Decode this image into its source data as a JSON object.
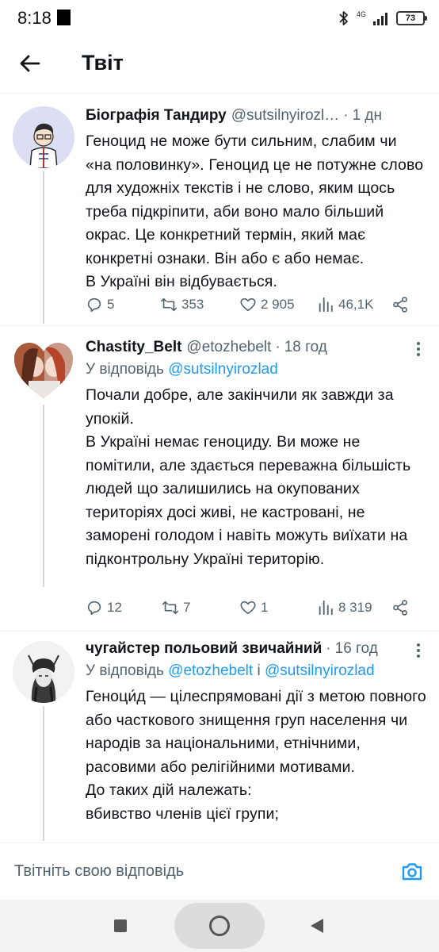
{
  "status_bar": {
    "time": "8:18",
    "network": "4G",
    "battery": "73"
  },
  "header": {
    "title": "Твіт"
  },
  "tweets": [
    {
      "author": "Біографія Тандиру",
      "handle": "@sutsilnyirozl…",
      "time": "1 дн",
      "text": "Геноцид не може бути сильним, слабим чи «на половинку». Геноцид це не потужне слово для художніх текстів і не слово, яким щось треба підкріпити, аби воно мало більший окрас. Це конкретний термін, який має конкретні ознаки. Він або є або немає.\nВ Україні він відбувається.",
      "replies": "5",
      "retweets": "353",
      "likes": "2 905",
      "views": "46,1K"
    },
    {
      "author": "Chastity_Belt",
      "handle": "@etozhebelt",
      "time": "18 год",
      "reply_prefix": "У відповідь",
      "reply_mention": "@sutsilnyirozlad",
      "text": "Почали добре, але закінчили як завжди за упокій.\nВ Україні немає геноциду. Ви може не помітили, але здається переважна більшість людей що залишились на окупованих територіях досі живі, не кастровані, не заморені голодом і навіть можуть виїхати на підконтрольну Україні територію.",
      "replies": "12",
      "retweets": "7",
      "likes": "1",
      "views": "8 319"
    },
    {
      "author": "чугайстер польовий звичайний",
      "time": "16 год",
      "reply_prefix": "У відповідь",
      "reply_mention": "@etozhebelt",
      "reply_join": "і",
      "reply_mention2": "@sutsilnyirozlad",
      "text": "Геноци́д — цілеспрямовані дії з метою повного або часткового знищення груп населення чи народів за національними, етнічними, расовими або релігійними мотивами.\nДо таких дій належать:\nвбивство членів цієї групи;"
    }
  ],
  "reply_bar": {
    "placeholder": "Твітніть свою відповідь"
  },
  "colors": {
    "accent": "#1d9bf0",
    "secondary_text": "#536471",
    "text": "#0f1419"
  }
}
